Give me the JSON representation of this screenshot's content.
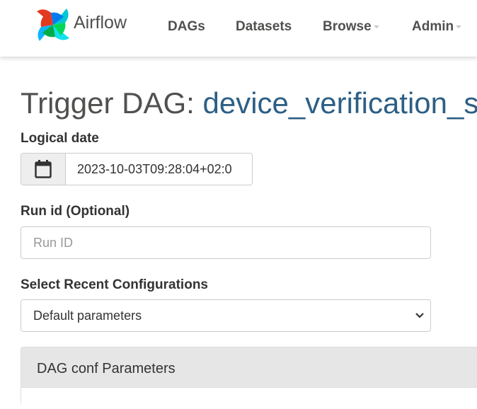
{
  "navbar": {
    "brand": "Airflow",
    "items": [
      {
        "label": "DAGs",
        "dropdown": false
      },
      {
        "label": "Datasets",
        "dropdown": false
      },
      {
        "label": "Browse",
        "dropdown": true
      },
      {
        "label": "Admin",
        "dropdown": true
      }
    ]
  },
  "page": {
    "title_prefix": "Trigger DAG:",
    "dag_id": "device_verification_s"
  },
  "form": {
    "logical_date": {
      "label": "Logical date",
      "value": "2023-10-03T09:28:04+02:0",
      "icon": "calendar-icon"
    },
    "run_id": {
      "label": "Run id (Optional)",
      "placeholder": "Run ID",
      "value": ""
    },
    "recent_configs": {
      "label": "Select Recent Configurations",
      "selected": "Default parameters"
    }
  },
  "panel": {
    "heading": "DAG conf Parameters"
  },
  "colors": {
    "dag_id": "#2d5f85",
    "nav_text": "#51504f",
    "addon_bg": "#eeeeee",
    "panel_bg": "#e6e6e6"
  }
}
